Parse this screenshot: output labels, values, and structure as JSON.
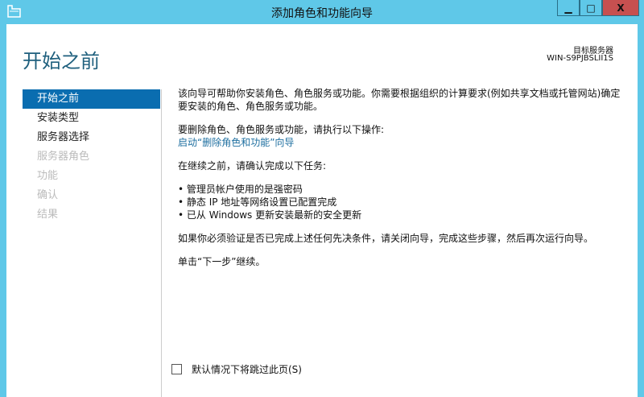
{
  "window": {
    "title": "添加角色和功能向导",
    "minimize": "▁",
    "maximize": "□",
    "close": "X"
  },
  "header": {
    "title": "开始之前",
    "target_label": "目标服务器",
    "target_name": "WIN-S9PJBSLII1S"
  },
  "sidebar": {
    "items": [
      {
        "label": "开始之前",
        "state": "active"
      },
      {
        "label": "安装类型",
        "state": "enabled"
      },
      {
        "label": "服务器选择",
        "state": "enabled"
      },
      {
        "label": "服务器角色",
        "state": "disabled"
      },
      {
        "label": "功能",
        "state": "disabled"
      },
      {
        "label": "确认",
        "state": "disabled"
      },
      {
        "label": "结果",
        "state": "disabled"
      }
    ]
  },
  "main": {
    "intro": "该向导可帮助你安装角色、角色服务或功能。你需要根据组织的计算要求(例如共享文档或托管网站)确定要安装的角色、角色服务或功能。",
    "remove_text": "要删除角色、角色服务或功能，请执行以下操作:",
    "remove_link": "启动“删除角色和功能”向导",
    "confirm_text": "在继续之前，请确认完成以下任务:",
    "tasks": [
      "管理员帐户使用的是强密码",
      "静态 IP 地址等网络设置已配置完成",
      "已从 Windows 更新安装最新的安全更新"
    ],
    "verify_text": "如果你必须验证是否已完成上述任何先决条件，请关闭向导，完成这些步骤，然后再次运行向导。",
    "next_text": "单击“下一步”继续。"
  },
  "footer": {
    "skip_label": "默认情况下将跳过此页(S)",
    "skip_checked": false
  }
}
